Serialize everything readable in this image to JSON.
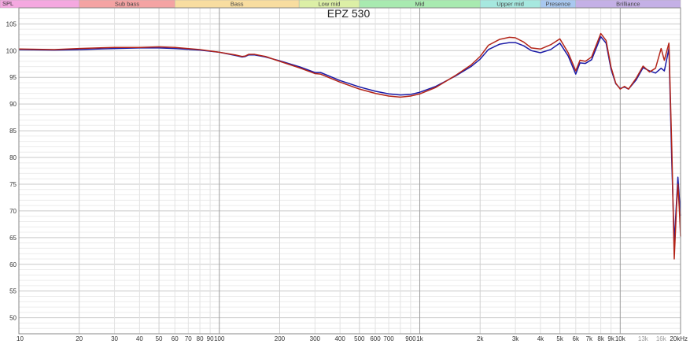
{
  "chart_data": {
    "type": "line",
    "title": "EPZ 530",
    "ylabel": "SPL",
    "x_unit_label": "20kHz",
    "xscale": "log",
    "xlim": [
      10,
      20000
    ],
    "ylim": [
      47,
      108
    ],
    "grid": true,
    "y_ticks": [
      50,
      55,
      60,
      65,
      70,
      75,
      80,
      85,
      90,
      95,
      100,
      105
    ],
    "y_tick_labels": [
      "50",
      "55",
      "60",
      "65",
      "70",
      "75",
      "80",
      "85",
      "90",
      "95",
      "100",
      "105"
    ],
    "x_ticks": [
      {
        "value": 10,
        "label": "10",
        "muted": false
      },
      {
        "value": 20,
        "label": "20",
        "muted": false
      },
      {
        "value": 30,
        "label": "30",
        "muted": false
      },
      {
        "value": 40,
        "label": "40",
        "muted": false
      },
      {
        "value": 50,
        "label": "50",
        "muted": false
      },
      {
        "value": 60,
        "label": "60",
        "muted": false
      },
      {
        "value": 70,
        "label": "70",
        "muted": false
      },
      {
        "value": 80,
        "label": "80",
        "muted": false
      },
      {
        "value": 90,
        "label": "90",
        "muted": false
      },
      {
        "value": 100,
        "label": "100",
        "muted": false
      },
      {
        "value": 200,
        "label": "200",
        "muted": false
      },
      {
        "value": 300,
        "label": "300",
        "muted": false
      },
      {
        "value": 400,
        "label": "400",
        "muted": false
      },
      {
        "value": 500,
        "label": "500",
        "muted": false
      },
      {
        "value": 600,
        "label": "600",
        "muted": false
      },
      {
        "value": 700,
        "label": "700",
        "muted": false
      },
      {
        "value": 900,
        "label": "900",
        "muted": false
      },
      {
        "value": 1000,
        "label": "1k",
        "muted": false
      },
      {
        "value": 2000,
        "label": "2k",
        "muted": false
      },
      {
        "value": 3000,
        "label": "3k",
        "muted": false
      },
      {
        "value": 4000,
        "label": "4k",
        "muted": false
      },
      {
        "value": 5000,
        "label": "5k",
        "muted": false
      },
      {
        "value": 6000,
        "label": "6k",
        "muted": false
      },
      {
        "value": 7000,
        "label": "7k",
        "muted": false
      },
      {
        "value": 8000,
        "label": "8k",
        "muted": false
      },
      {
        "value": 9000,
        "label": "9k",
        "muted": false
      },
      {
        "value": 10000,
        "label": "10k",
        "muted": false
      },
      {
        "value": 13000,
        "label": "13k",
        "muted": true
      },
      {
        "value": 16000,
        "label": "16k",
        "muted": true
      }
    ],
    "bands": [
      {
        "label": "",
        "from": 6,
        "to": 20,
        "color": "#f4a8e0"
      },
      {
        "label": "Sub bass",
        "from": 20,
        "to": 60,
        "color": "#f4a3a3"
      },
      {
        "label": "Bass",
        "from": 60,
        "to": 250,
        "color": "#f8dda0"
      },
      {
        "label": "Low mid",
        "from": 250,
        "to": 500,
        "color": "#dcefa6"
      },
      {
        "label": "Mid",
        "from": 500,
        "to": 2000,
        "color": "#a8eab0"
      },
      {
        "label": "Upper mid",
        "from": 2000,
        "to": 4000,
        "color": "#a6e8df"
      },
      {
        "label": "Presence",
        "from": 4000,
        "to": 6000,
        "color": "#a8c8f0"
      },
      {
        "label": "Brilliance",
        "from": 6000,
        "to": 20000,
        "color": "#c4b0e6"
      }
    ],
    "series": [
      {
        "color": "#1a1aa6",
        "points": [
          [
            10,
            100.2
          ],
          [
            15,
            100.1
          ],
          [
            20,
            100.2
          ],
          [
            30,
            100.4
          ],
          [
            40,
            100.5
          ],
          [
            50,
            100.5
          ],
          [
            60,
            100.4
          ],
          [
            80,
            100.1
          ],
          [
            100,
            99.7
          ],
          [
            120,
            99.1
          ],
          [
            130,
            98.8
          ],
          [
            135,
            98.9
          ],
          [
            140,
            99.2
          ],
          [
            150,
            99.2
          ],
          [
            170,
            98.8
          ],
          [
            200,
            98.1
          ],
          [
            250,
            97.0
          ],
          [
            300,
            95.9
          ],
          [
            320,
            95.9
          ],
          [
            400,
            94.4
          ],
          [
            500,
            93.2
          ],
          [
            600,
            92.4
          ],
          [
            700,
            91.9
          ],
          [
            800,
            91.7
          ],
          [
            900,
            91.8
          ],
          [
            1000,
            92.2
          ],
          [
            1200,
            93.3
          ],
          [
            1500,
            95.2
          ],
          [
            1800,
            97.0
          ],
          [
            2000,
            98.4
          ],
          [
            2200,
            100.2
          ],
          [
            2500,
            101.2
          ],
          [
            2800,
            101.5
          ],
          [
            3000,
            101.5
          ],
          [
            3300,
            100.9
          ],
          [
            3600,
            100.0
          ],
          [
            4000,
            99.6
          ],
          [
            4500,
            100.2
          ],
          [
            5000,
            101.4
          ],
          [
            5500,
            99.0
          ],
          [
            6000,
            95.6
          ],
          [
            6300,
            97.7
          ],
          [
            6700,
            97.6
          ],
          [
            7200,
            98.3
          ],
          [
            8000,
            102.6
          ],
          [
            8500,
            101.4
          ],
          [
            9000,
            96.5
          ],
          [
            9500,
            93.8
          ],
          [
            10000,
            92.9
          ],
          [
            10500,
            93.2
          ],
          [
            11000,
            92.8
          ],
          [
            12000,
            94.5
          ],
          [
            13000,
            96.8
          ],
          [
            14000,
            96.2
          ],
          [
            15000,
            95.8
          ],
          [
            16000,
            96.7
          ],
          [
            16600,
            96.2
          ],
          [
            17500,
            100.4
          ],
          [
            18100,
            78.5
          ],
          [
            18600,
            64.1
          ],
          [
            19100,
            71.8
          ],
          [
            19400,
            76.3
          ],
          [
            19700,
            72.6
          ],
          [
            20000,
            69.1
          ]
        ]
      },
      {
        "color": "#b32418",
        "points": [
          [
            10,
            100.3
          ],
          [
            15,
            100.2
          ],
          [
            20,
            100.4
          ],
          [
            30,
            100.6
          ],
          [
            40,
            100.6
          ],
          [
            50,
            100.7
          ],
          [
            60,
            100.6
          ],
          [
            80,
            100.2
          ],
          [
            100,
            99.7
          ],
          [
            120,
            99.2
          ],
          [
            130,
            98.9
          ],
          [
            135,
            99.0
          ],
          [
            140,
            99.3
          ],
          [
            150,
            99.3
          ],
          [
            170,
            98.9
          ],
          [
            200,
            98.0
          ],
          [
            250,
            96.8
          ],
          [
            300,
            95.7
          ],
          [
            320,
            95.6
          ],
          [
            400,
            94.1
          ],
          [
            500,
            92.8
          ],
          [
            600,
            92.0
          ],
          [
            700,
            91.5
          ],
          [
            800,
            91.3
          ],
          [
            900,
            91.5
          ],
          [
            1000,
            91.9
          ],
          [
            1200,
            93.1
          ],
          [
            1500,
            95.3
          ],
          [
            1800,
            97.3
          ],
          [
            2000,
            98.9
          ],
          [
            2200,
            101.0
          ],
          [
            2500,
            102.1
          ],
          [
            2800,
            102.5
          ],
          [
            3000,
            102.4
          ],
          [
            3300,
            101.6
          ],
          [
            3600,
            100.5
          ],
          [
            4000,
            100.3
          ],
          [
            4500,
            101.1
          ],
          [
            5000,
            102.2
          ],
          [
            5500,
            99.6
          ],
          [
            6000,
            96.2
          ],
          [
            6300,
            98.2
          ],
          [
            6700,
            98.0
          ],
          [
            7200,
            98.8
          ],
          [
            8000,
            103.2
          ],
          [
            8500,
            101.9
          ],
          [
            9000,
            96.9
          ],
          [
            9500,
            93.9
          ],
          [
            10000,
            92.8
          ],
          [
            10500,
            93.3
          ],
          [
            11000,
            92.8
          ],
          [
            12000,
            94.8
          ],
          [
            13000,
            97.1
          ],
          [
            14000,
            96.0
          ],
          [
            15000,
            96.7
          ],
          [
            16000,
            100.4
          ],
          [
            16600,
            98.2
          ],
          [
            17500,
            101.4
          ],
          [
            18100,
            81.2
          ],
          [
            18600,
            61.0
          ],
          [
            19100,
            70.8
          ],
          [
            19400,
            75.0
          ],
          [
            19700,
            70.6
          ],
          [
            20000,
            65.2
          ]
        ]
      }
    ]
  }
}
